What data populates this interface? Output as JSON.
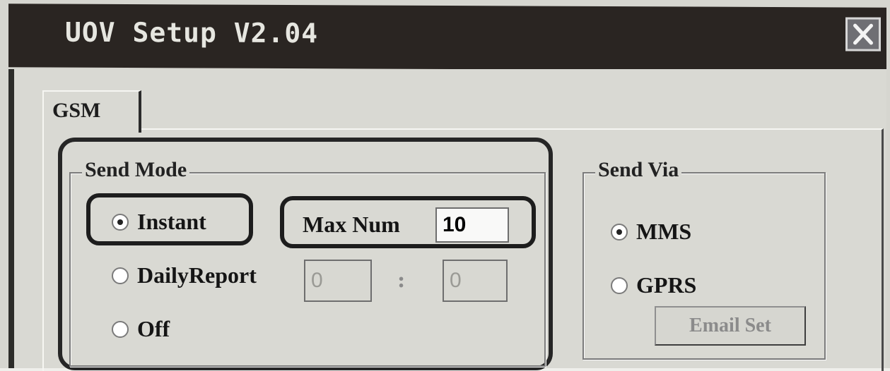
{
  "window": {
    "title": "UOV Setup V2.04",
    "close_icon": "close-icon"
  },
  "tabs": [
    {
      "label": "GSM"
    }
  ],
  "send_mode": {
    "title": "Send Mode",
    "options": [
      {
        "label": "Instant",
        "checked": true
      },
      {
        "label": "DailyReport",
        "checked": false
      },
      {
        "label": "Off",
        "checked": false
      }
    ],
    "max_num": {
      "label": "Max Num",
      "value": "10"
    },
    "daily_time": {
      "hour": "0",
      "separator": ":",
      "minute": "0"
    }
  },
  "send_via": {
    "title": "Send Via",
    "options": [
      {
        "label": "MMS",
        "checked": true
      },
      {
        "label": "GPRS",
        "checked": false
      }
    ],
    "email_button": "Email Set"
  }
}
